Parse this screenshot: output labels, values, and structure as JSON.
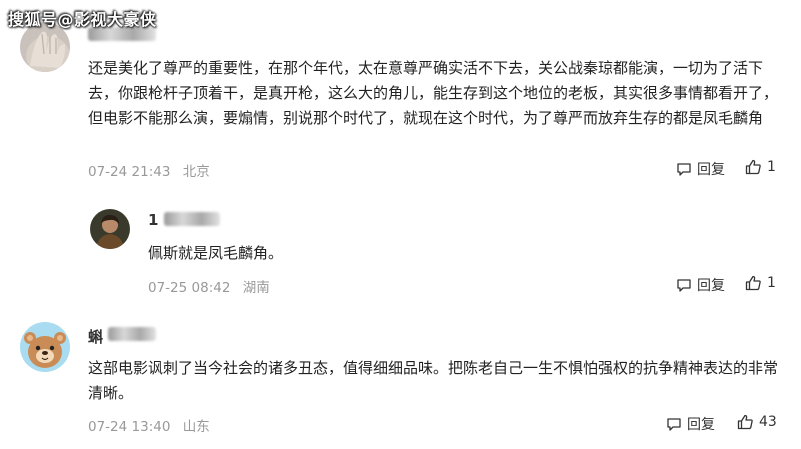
{
  "watermark": "搜狐号@影视大豪侠",
  "comments": [
    {
      "name_prefix": "",
      "body": "还是美化了尊严的重要性，在那个年代，太在意尊严确实活不下去，关公战秦琼都能演，一切为了活下去，你跟枪杆子顶着干，是真开枪，这么大的角儿，能生存到这个地位的老板，其实很多事情都看开了，但电影不能那么演，要煽情，别说那个时代了，就现在这个时代，为了尊严而放弃生存的都是凤毛麟角",
      "date": "07-24 21:43",
      "location": "北京",
      "reply_label": "回复",
      "likes": "1"
    },
    {
      "name_prefix": "1",
      "body": "佩斯就是凤毛麟角。",
      "date": "07-25 08:42",
      "location": "湖南",
      "reply_label": "回复",
      "likes": "1"
    },
    {
      "name_prefix": "蝌",
      "body": "这部电影讽刺了当今社会的诸多丑态，值得细细品味。把陈老自己一生不惧怕强权的抗争精神表达的非常清晰。",
      "date": "07-24 13:40",
      "location": "山东",
      "reply_label": "回复",
      "likes": "43"
    }
  ]
}
